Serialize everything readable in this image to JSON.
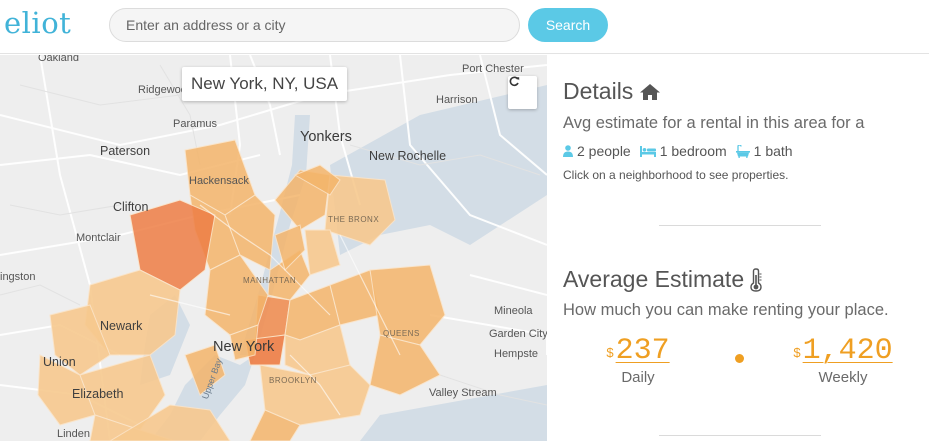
{
  "header": {
    "logo": "eliot",
    "search_placeholder": "Enter an address or a city",
    "search_button_label": "Search"
  },
  "map": {
    "location_label": "New York, NY, USA",
    "refresh_icon": "refresh-icon",
    "place_labels": {
      "oakland": "Oakland",
      "port_chester": "Port Chester",
      "ridgewood": "Ridgewood",
      "harrison": "Harrison",
      "paramus": "Paramus",
      "yonkers": "Yonkers",
      "paterson": "Paterson",
      "new_rochelle": "New Rochelle",
      "hackensack": "Hackensack",
      "clifton": "Clifton",
      "the_bronx": "THE BRONX",
      "montclair": "Montclair",
      "livingston": "ingston",
      "manhattan": "MANHATTAN",
      "mineola": "Mineola",
      "newark": "Newark",
      "queens": "QUEENS",
      "garden_city": "Garden City",
      "new_york": "New York",
      "hempstead": "Hempste",
      "union": "Union",
      "brooklyn": "BROOKLYN",
      "upper_bay": "Upper Bay",
      "elizabeth": "Elizabeth",
      "valley_stream": "Valley Stream",
      "linden": "Linden"
    },
    "colors": {
      "light": "#f7c98f",
      "mid": "#f4b56b",
      "dark": "#f08f54",
      "darker": "#ee7e45",
      "water": "#d3dde6",
      "land": "#eeeeee",
      "road": "#ffffff",
      "border": "#fbe3c6"
    }
  },
  "details": {
    "title": "Details",
    "title_icon": "home-icon",
    "subtitle": "Avg estimate for a rental in this area for a",
    "specs": [
      {
        "icon": "user-icon",
        "label": "2 people"
      },
      {
        "icon": "bed-icon",
        "label": "1 bedroom"
      },
      {
        "icon": "bath-icon",
        "label": "1 bath"
      }
    ],
    "hint": "Click on a neighborhood to see properties."
  },
  "average": {
    "title": "Average Estimate",
    "title_icon": "thermometer-icon",
    "subtitle": "How much you can make renting your place.",
    "daily": {
      "currency": "$",
      "value": "237",
      "label": "Daily"
    },
    "weekly": {
      "currency": "$",
      "value": "1,420",
      "label": "Weekly"
    }
  },
  "accent_color": "#ef9f22",
  "brand_color": "#41b3d8"
}
